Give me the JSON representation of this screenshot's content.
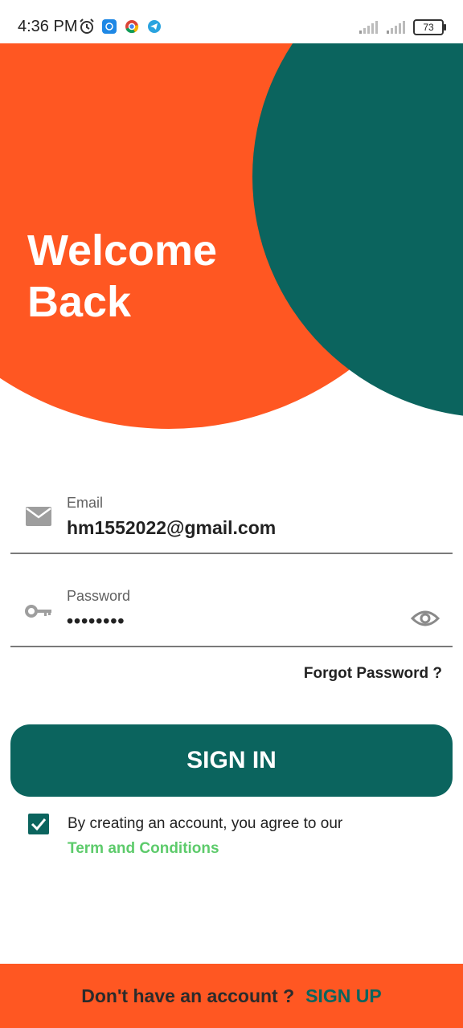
{
  "status_bar": {
    "time": "4:36 PM",
    "battery": "73",
    "icons": [
      "alarm-icon",
      "app-icon",
      "chrome-icon",
      "telegram-icon",
      "signal-icon",
      "signal-icon",
      "battery-icon"
    ]
  },
  "header": {
    "welcome_line1": "Welcome",
    "welcome_line2": "Back"
  },
  "form": {
    "email": {
      "label": "Email",
      "value": "hm1552022@gmail.com",
      "icon": "mail-icon"
    },
    "password": {
      "label": "Password",
      "value": "••••••••",
      "icon": "key-icon",
      "toggle_icon": "eye-icon"
    },
    "forgot_label": "Forgot Password ?",
    "signin_label": "SIGN IN",
    "terms_text": "By creating an account, you agree to our",
    "terms_link": "Term and Conditions",
    "terms_checked": true
  },
  "footer": {
    "text": "Don't have an account ?",
    "link": "SIGN UP"
  },
  "colors": {
    "orange": "#FF5722",
    "teal": "#0B645E",
    "green_link": "#5DCB6B"
  }
}
